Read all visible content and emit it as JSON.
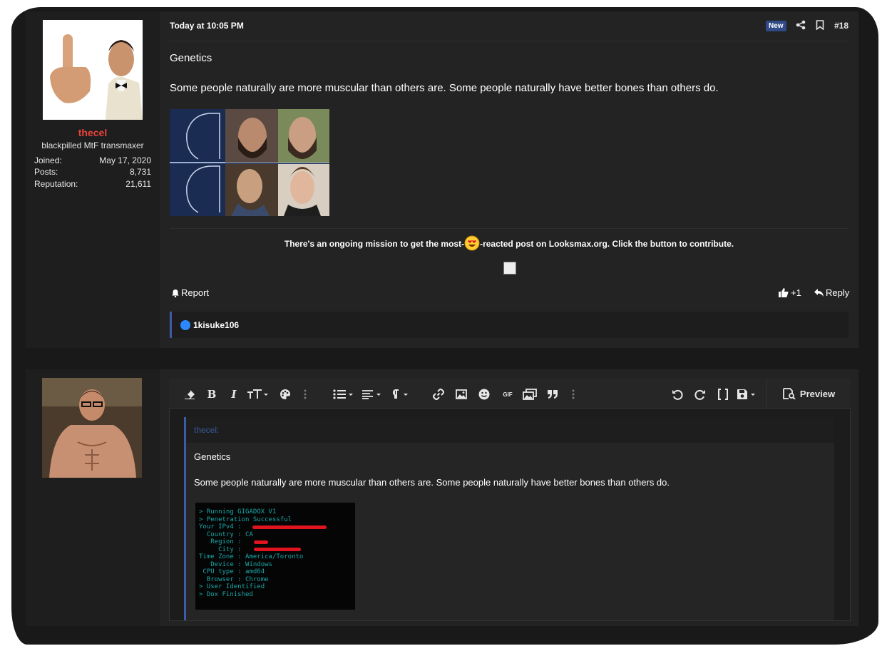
{
  "post": {
    "user": {
      "name": "thecel",
      "title": "blackpilled MtF transmaxer",
      "stats": [
        {
          "label": "Joined:",
          "value": "May 17, 2020"
        },
        {
          "label": "Posts:",
          "value": "8,731"
        },
        {
          "label": "Reputation:",
          "value": "21,611"
        }
      ]
    },
    "date": "Today at 10:05 PM",
    "badge": "New",
    "number": "#18",
    "title": "Genetics",
    "body": "Some people naturally are more muscular than others are. Some people naturally have better bones than others do.",
    "mission_before": "There's an ongoing mission to get the most-",
    "mission_after": "-reacted post on Looksmax.org. Click the button to contribute.",
    "actions": {
      "report": "Report",
      "like": "+1",
      "reply": "Reply"
    },
    "reaction_user": "1kisuke106"
  },
  "editor": {
    "preview_label": "Preview",
    "quote_author": "thecel:",
    "quote_title": "Genetics",
    "quote_body": "Some people naturally are more muscular than others are. Some people naturally have better bones than others do.",
    "gif_label": "GIF",
    "terminal_lines": [
      "> Running GIGADOX V1",
      "> Penetration Successful",
      "Your IPv4 : ",
      "  Country : CA",
      "   Region : ",
      "     City : ",
      "Time Zone : America/Toronto",
      "   Device : Windows",
      " CPU type : amd64",
      "  Browser : Chrome",
      "> User Identified",
      "> Dox Finished"
    ]
  },
  "colors": {
    "background": "#191919",
    "panel": "#232323",
    "username": "#e8443a",
    "accent": "#3d5ca8",
    "terminal_text": "#1aa8a8"
  }
}
